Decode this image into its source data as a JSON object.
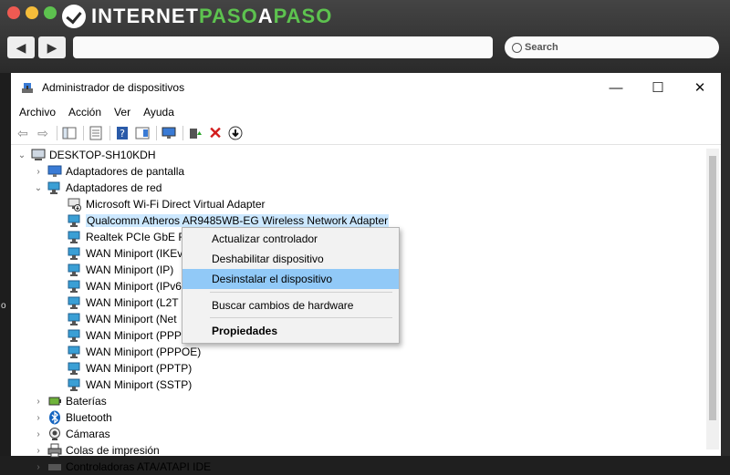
{
  "brand": {
    "part1": "INTERNET",
    "part2": "PASO",
    "part3": "A",
    "part4": "PASO"
  },
  "browser": {
    "search_placeholder": "Search"
  },
  "window": {
    "title": "Administrador de dispositivos",
    "min": "—",
    "max": "☐",
    "close": "✕"
  },
  "menu": [
    "Archivo",
    "Acción",
    "Ver",
    "Ayuda"
  ],
  "tree": {
    "root": "DESKTOP-SH10KDH",
    "items": [
      {
        "label": "Adaptadores de pantalla",
        "icon": "monitor-icon"
      },
      {
        "label": "Adaptadores de red",
        "icon": "network-adapter-icon"
      },
      {
        "label": "Microsoft Wi-Fi Direct Virtual Adapter",
        "icon": "network-adapter-disabled-icon"
      },
      {
        "label": "Qualcomm Atheros AR9485WB-EG Wireless Network Adapter",
        "icon": "network-adapter-icon"
      },
      {
        "label": "Realtek PCIe GbE Fa",
        "icon": "network-adapter-icon"
      },
      {
        "label": "WAN Miniport (IKEv",
        "icon": "network-adapter-icon"
      },
      {
        "label": "WAN Miniport (IP)",
        "icon": "network-adapter-icon"
      },
      {
        "label": "WAN Miniport (IPv6",
        "icon": "network-adapter-icon"
      },
      {
        "label": "WAN Miniport (L2T",
        "icon": "network-adapter-icon"
      },
      {
        "label": "WAN Miniport (Net",
        "icon": "network-adapter-icon"
      },
      {
        "label": "WAN Miniport (PPP",
        "icon": "network-adapter-icon"
      },
      {
        "label": "WAN Miniport (PPPOE)",
        "icon": "network-adapter-icon"
      },
      {
        "label": "WAN Miniport (PPTP)",
        "icon": "network-adapter-icon"
      },
      {
        "label": "WAN Miniport (SSTP)",
        "icon": "network-adapter-icon"
      },
      {
        "label": "Baterías",
        "icon": "battery-icon"
      },
      {
        "label": "Bluetooth",
        "icon": "bluetooth-icon"
      },
      {
        "label": "Cámaras",
        "icon": "camera-icon"
      },
      {
        "label": "Colas de impresión",
        "icon": "printer-icon"
      },
      {
        "label": "Controladoras ATA/ATAPI IDE",
        "icon": "ide-controller-icon"
      }
    ]
  },
  "context_menu": {
    "items": [
      "Actualizar controlador",
      "Deshabilitar dispositivo",
      "Desinstalar el dispositivo",
      "Buscar cambios de hardware",
      "Propiedades"
    ],
    "highlighted": "Desinstalar el dispositivo"
  },
  "edge_left": "o"
}
